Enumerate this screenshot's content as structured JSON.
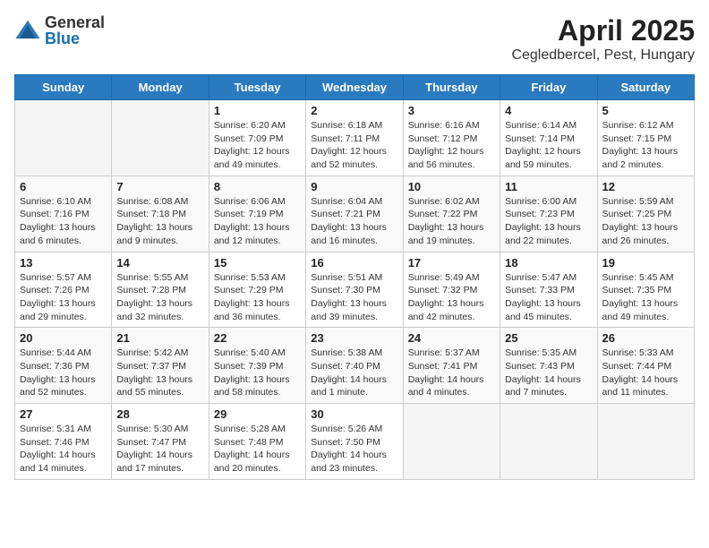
{
  "logo": {
    "general": "General",
    "blue": "Blue"
  },
  "header": {
    "title": "April 2025",
    "subtitle": "Cegledbercel, Pest, Hungary"
  },
  "weekdays": [
    "Sunday",
    "Monday",
    "Tuesday",
    "Wednesday",
    "Thursday",
    "Friday",
    "Saturday"
  ],
  "weeks": [
    [
      {
        "day": "",
        "info": ""
      },
      {
        "day": "",
        "info": ""
      },
      {
        "day": "1",
        "info": "Sunrise: 6:20 AM\nSunset: 7:09 PM\nDaylight: 12 hours and 49 minutes."
      },
      {
        "day": "2",
        "info": "Sunrise: 6:18 AM\nSunset: 7:11 PM\nDaylight: 12 hours and 52 minutes."
      },
      {
        "day": "3",
        "info": "Sunrise: 6:16 AM\nSunset: 7:12 PM\nDaylight: 12 hours and 56 minutes."
      },
      {
        "day": "4",
        "info": "Sunrise: 6:14 AM\nSunset: 7:14 PM\nDaylight: 12 hours and 59 minutes."
      },
      {
        "day": "5",
        "info": "Sunrise: 6:12 AM\nSunset: 7:15 PM\nDaylight: 13 hours and 2 minutes."
      }
    ],
    [
      {
        "day": "6",
        "info": "Sunrise: 6:10 AM\nSunset: 7:16 PM\nDaylight: 13 hours and 6 minutes."
      },
      {
        "day": "7",
        "info": "Sunrise: 6:08 AM\nSunset: 7:18 PM\nDaylight: 13 hours and 9 minutes."
      },
      {
        "day": "8",
        "info": "Sunrise: 6:06 AM\nSunset: 7:19 PM\nDaylight: 13 hours and 12 minutes."
      },
      {
        "day": "9",
        "info": "Sunrise: 6:04 AM\nSunset: 7:21 PM\nDaylight: 13 hours and 16 minutes."
      },
      {
        "day": "10",
        "info": "Sunrise: 6:02 AM\nSunset: 7:22 PM\nDaylight: 13 hours and 19 minutes."
      },
      {
        "day": "11",
        "info": "Sunrise: 6:00 AM\nSunset: 7:23 PM\nDaylight: 13 hours and 22 minutes."
      },
      {
        "day": "12",
        "info": "Sunrise: 5:59 AM\nSunset: 7:25 PM\nDaylight: 13 hours and 26 minutes."
      }
    ],
    [
      {
        "day": "13",
        "info": "Sunrise: 5:57 AM\nSunset: 7:26 PM\nDaylight: 13 hours and 29 minutes."
      },
      {
        "day": "14",
        "info": "Sunrise: 5:55 AM\nSunset: 7:28 PM\nDaylight: 13 hours and 32 minutes."
      },
      {
        "day": "15",
        "info": "Sunrise: 5:53 AM\nSunset: 7:29 PM\nDaylight: 13 hours and 36 minutes."
      },
      {
        "day": "16",
        "info": "Sunrise: 5:51 AM\nSunset: 7:30 PM\nDaylight: 13 hours and 39 minutes."
      },
      {
        "day": "17",
        "info": "Sunrise: 5:49 AM\nSunset: 7:32 PM\nDaylight: 13 hours and 42 minutes."
      },
      {
        "day": "18",
        "info": "Sunrise: 5:47 AM\nSunset: 7:33 PM\nDaylight: 13 hours and 45 minutes."
      },
      {
        "day": "19",
        "info": "Sunrise: 5:45 AM\nSunset: 7:35 PM\nDaylight: 13 hours and 49 minutes."
      }
    ],
    [
      {
        "day": "20",
        "info": "Sunrise: 5:44 AM\nSunset: 7:36 PM\nDaylight: 13 hours and 52 minutes."
      },
      {
        "day": "21",
        "info": "Sunrise: 5:42 AM\nSunset: 7:37 PM\nDaylight: 13 hours and 55 minutes."
      },
      {
        "day": "22",
        "info": "Sunrise: 5:40 AM\nSunset: 7:39 PM\nDaylight: 13 hours and 58 minutes."
      },
      {
        "day": "23",
        "info": "Sunrise: 5:38 AM\nSunset: 7:40 PM\nDaylight: 14 hours and 1 minute."
      },
      {
        "day": "24",
        "info": "Sunrise: 5:37 AM\nSunset: 7:41 PM\nDaylight: 14 hours and 4 minutes."
      },
      {
        "day": "25",
        "info": "Sunrise: 5:35 AM\nSunset: 7:43 PM\nDaylight: 14 hours and 7 minutes."
      },
      {
        "day": "26",
        "info": "Sunrise: 5:33 AM\nSunset: 7:44 PM\nDaylight: 14 hours and 11 minutes."
      }
    ],
    [
      {
        "day": "27",
        "info": "Sunrise: 5:31 AM\nSunset: 7:46 PM\nDaylight: 14 hours and 14 minutes."
      },
      {
        "day": "28",
        "info": "Sunrise: 5:30 AM\nSunset: 7:47 PM\nDaylight: 14 hours and 17 minutes."
      },
      {
        "day": "29",
        "info": "Sunrise: 5:28 AM\nSunset: 7:48 PM\nDaylight: 14 hours and 20 minutes."
      },
      {
        "day": "30",
        "info": "Sunrise: 5:26 AM\nSunset: 7:50 PM\nDaylight: 14 hours and 23 minutes."
      },
      {
        "day": "",
        "info": ""
      },
      {
        "day": "",
        "info": ""
      },
      {
        "day": "",
        "info": ""
      }
    ]
  ]
}
